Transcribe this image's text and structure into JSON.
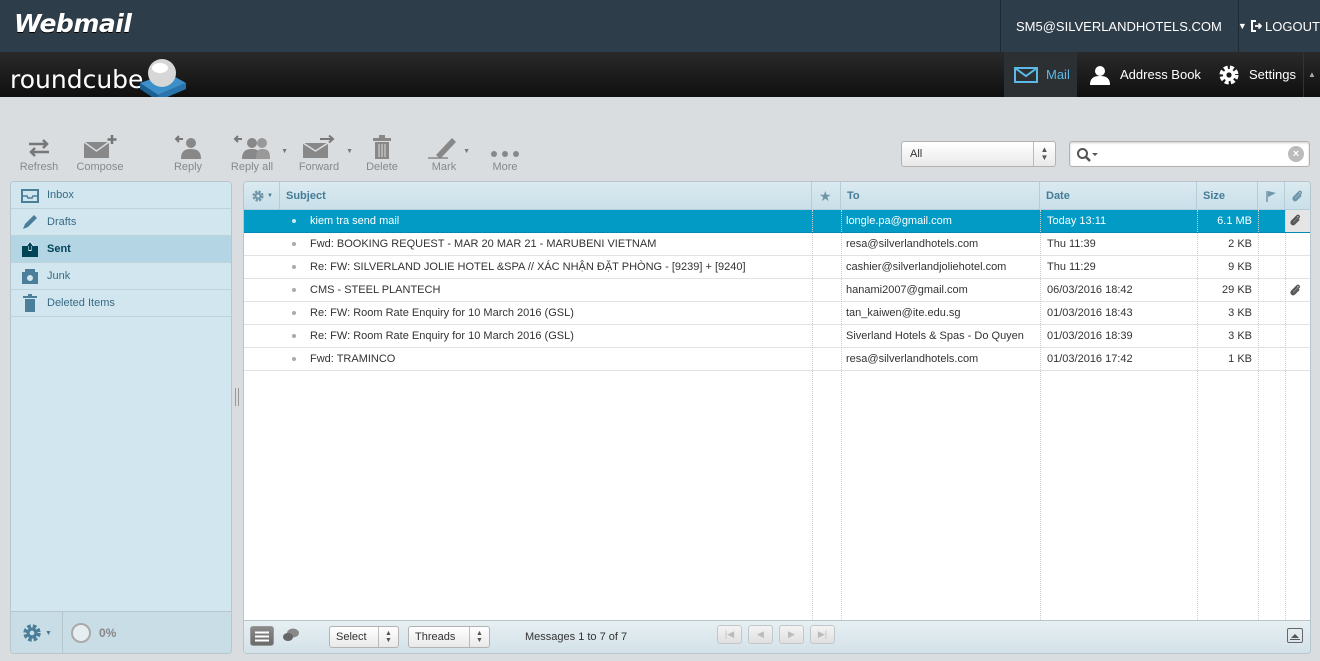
{
  "topbar": {
    "brand": "Webmail",
    "user_email": "SM5@SILVERLANDHOTELS.COM",
    "logout_label": "LOGOUT"
  },
  "header": {
    "logo_text": "roundcube",
    "nav": [
      {
        "label": "Mail",
        "icon": "mail-icon",
        "active": true
      },
      {
        "label": "Address Book",
        "icon": "person-icon",
        "active": false
      },
      {
        "label": "Settings",
        "icon": "gear-icon",
        "active": false
      }
    ]
  },
  "toolbar": {
    "refresh": "Refresh",
    "compose": "Compose",
    "reply": "Reply",
    "reply_all": "Reply all",
    "forward": "Forward",
    "delete": "Delete",
    "mark": "Mark",
    "more": "More",
    "filter_value": "All",
    "search_value": ""
  },
  "folders": [
    {
      "label": "Inbox",
      "icon": "inbox-icon",
      "active": false
    },
    {
      "label": "Drafts",
      "icon": "pencil-icon",
      "active": false
    },
    {
      "label": "Sent",
      "icon": "sent-icon",
      "active": true
    },
    {
      "label": "Junk",
      "icon": "junk-icon",
      "active": false
    },
    {
      "label": "Deleted Items",
      "icon": "trash-icon",
      "active": false
    }
  ],
  "quota": "0%",
  "columns": {
    "subject": "Subject",
    "to": "To",
    "date": "Date",
    "size": "Size"
  },
  "messages": [
    {
      "subject": "kiem tra send mail",
      "to": "longle.pa@gmail.com",
      "date": "Today 13:11",
      "size": "6.1 MB",
      "attachment": true,
      "selected": true
    },
    {
      "subject": "Fwd: BOOKING REQUEST - MAR 20 MAR 21 - MARUBENI VIETNAM",
      "to": "resa@silverlandhotels.com",
      "date": "Thu 11:39",
      "size": "2 KB",
      "attachment": false,
      "selected": false
    },
    {
      "subject": "Re: FW: SILVERLAND JOLIE HOTEL &SPA // XÁC NHẬN ĐẶT PHÒNG - [9239] + [9240]",
      "to": "cashier@silverlandjoliehotel.com",
      "date": "Thu 11:29",
      "size": "9 KB",
      "attachment": false,
      "selected": false
    },
    {
      "subject": "CMS - STEEL PLANTECH",
      "to": "hanami2007@gmail.com",
      "date": "06/03/2016 18:42",
      "size": "29 KB",
      "attachment": true,
      "selected": false
    },
    {
      "subject": "Re: FW: Room Rate Enquiry for 10 March 2016 (GSL)",
      "to": "tan_kaiwen@ite.edu.sg",
      "date": "01/03/2016 18:43",
      "size": "3 KB",
      "attachment": false,
      "selected": false
    },
    {
      "subject": "Re: FW: Room Rate Enquiry for 10 March 2016 (GSL)",
      "to": "Siverland Hotels & Spas - Do Quyen",
      "date": "01/03/2016 18:39",
      "size": "3 KB",
      "attachment": false,
      "selected": false
    },
    {
      "subject": "Fwd: TRAMINCO",
      "to": "resa@silverlandhotels.com",
      "date": "01/03/2016 17:42",
      "size": "1 KB",
      "attachment": false,
      "selected": false
    }
  ],
  "footer": {
    "select_label": "Select",
    "threads_label": "Threads",
    "count_text": "Messages 1 to 7 of 7"
  }
}
